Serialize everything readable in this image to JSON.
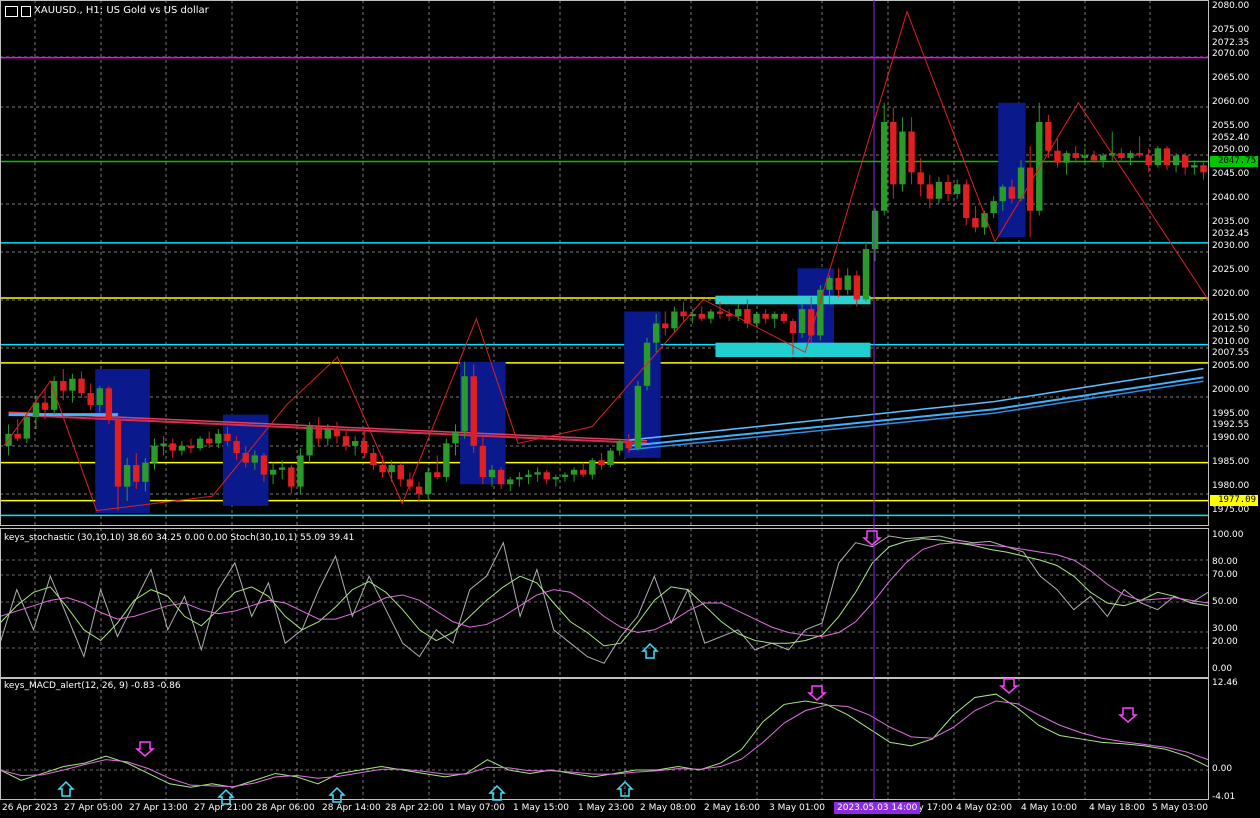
{
  "header": {
    "symbol_title": "XAUUSD., H1: US Gold vs US dollar"
  },
  "price_axis": {
    "labels": [
      "2080.00",
      "2075.00",
      "2072.35",
      "2070.00",
      "2065.00",
      "2060.00",
      "2055.00",
      "2052.40",
      "2050.00",
      "2047.75",
      "2045.00",
      "2040.00",
      "2035.00",
      "2032.45",
      "2030.00",
      "2025.00",
      "2020.00",
      "2015.00",
      "2012.50",
      "2010.00",
      "2007.55",
      "2005.00",
      "2000.00",
      "1995.00",
      "1992.55",
      "1990.00",
      "1985.00",
      "1980.00",
      "1977.09",
      "1975.00"
    ],
    "current_price": "2047.75",
    "highlight_price": "1977.09",
    "colors": {
      "magenta": "#ff00ff",
      "cyan": "#00e5ff",
      "yellow": "#ffff00",
      "green": "#00c800",
      "current_bg": "#00c800",
      "highlight_bg": "#ffff00"
    }
  },
  "stochastic": {
    "label": "keys_stochastic (30,10,10) 38.60 34.25 0.00 0.00 Stoch(30,10,1) 55.09 39.41",
    "axis": [
      "100.00",
      "80.00",
      "70.00",
      "50.00",
      "30.00",
      "20.00",
      "0.00"
    ]
  },
  "macd": {
    "label": "keys_MACD_alert(12, 26, 9) -0.83 -0.86",
    "axis": [
      "12.46",
      "0.00",
      "-4.01"
    ]
  },
  "time_axis": {
    "labels": [
      "26 Apr 2023",
      "27 Apr 05:00",
      "27 Apr 13:00",
      "27 Apr 21:00",
      "28 Apr 06:00",
      "28 Apr 14:00",
      "28 Apr 22:00",
      "1 May 07:00",
      "1 May 15:00",
      "1 May 23:00",
      "2 May 08:00",
      "2 May 16:00",
      "3 May 01:00",
      "ay 17:00",
      "4 May 02:00",
      "4 May 10:00",
      "4 May 18:00",
      "5 May 03:00"
    ],
    "crosshair": "2023.05.03 14:00"
  },
  "chart_data": {
    "type": "candlestick",
    "symbol": "XAUUSD.",
    "timeframe": "H1",
    "ylim": [
      1972,
      2081
    ],
    "horizontal_levels": [
      {
        "price": 2069.4,
        "color": "#ff00ff"
      },
      {
        "price": 2047.75,
        "color": "#00c800"
      },
      {
        "price": 2030.8,
        "color": "#00e5ff"
      },
      {
        "price": 2019.3,
        "color": "#ffff00"
      },
      {
        "price": 2009.6,
        "color": "#00e5ff"
      },
      {
        "price": 2005.8,
        "color": "#ffff00"
      },
      {
        "price": 1985.0,
        "color": "#ffff00"
      },
      {
        "price": 1977.09,
        "color": "#ffff00"
      },
      {
        "price": 1974.0,
        "color": "#00e5ff"
      }
    ],
    "candles": [
      [
        1988.5,
        1993.0,
        1986.5,
        1991.0
      ],
      [
        1991.0,
        1994.0,
        1989.5,
        1990.0
      ],
      [
        1990.0,
        1995.5,
        1989.0,
        1994.5
      ],
      [
        1994.5,
        1999.0,
        1992.0,
        1997.5
      ],
      [
        1997.5,
        2000.5,
        1994.0,
        1996.0
      ],
      [
        1996.0,
        2003.0,
        1995.0,
        2002.0
      ],
      [
        2002.0,
        2004.5,
        1998.0,
        2000.0
      ],
      [
        2000.0,
        2003.5,
        1997.5,
        2002.5
      ],
      [
        2002.5,
        2004.0,
        1998.5,
        1999.5
      ],
      [
        1999.5,
        2001.5,
        1996.0,
        1997.0
      ],
      [
        1997.0,
        2001.0,
        1995.5,
        2000.5
      ],
      [
        2000.5,
        2001.0,
        1993.0,
        1994.0
      ],
      [
        1994.0,
        1995.0,
        1975.0,
        1980.0
      ],
      [
        1980.0,
        1986.0,
        1977.0,
        1984.5
      ],
      [
        1984.5,
        1987.0,
        1979.5,
        1981.0
      ],
      [
        1981.0,
        1986.0,
        1979.0,
        1985.0
      ],
      [
        1985.0,
        1990.0,
        1983.5,
        1988.5
      ],
      [
        1988.5,
        1990.5,
        1986.5,
        1989.0
      ],
      [
        1989.0,
        1990.0,
        1986.0,
        1987.5
      ],
      [
        1987.5,
        1989.5,
        1986.5,
        1988.5
      ],
      [
        1988.5,
        1990.0,
        1987.0,
        1988.0
      ],
      [
        1988.0,
        1990.5,
        1987.5,
        1990.0
      ],
      [
        1990.0,
        1991.5,
        1988.0,
        1989.0
      ],
      [
        1989.0,
        1992.0,
        1988.0,
        1991.0
      ],
      [
        1991.0,
        1992.5,
        1988.5,
        1989.5
      ],
      [
        1989.5,
        1990.5,
        1985.5,
        1987.0
      ],
      [
        1987.0,
        1988.5,
        1984.0,
        1985.0
      ],
      [
        1985.0,
        1987.5,
        1983.5,
        1986.5
      ],
      [
        1986.5,
        1987.0,
        1981.0,
        1982.5
      ],
      [
        1982.5,
        1985.0,
        1980.5,
        1983.5
      ],
      [
        1983.5,
        1985.5,
        1981.5,
        1984.0
      ],
      [
        1984.0,
        1984.5,
        1978.5,
        1980.0
      ],
      [
        1980.0,
        1988.0,
        1978.5,
        1986.5
      ],
      [
        1986.5,
        1993.5,
        1985.0,
        1992.5
      ],
      [
        1992.5,
        1994.5,
        1988.5,
        1990.0
      ],
      [
        1990.0,
        1993.0,
        1988.5,
        1992.0
      ],
      [
        1992.0,
        1993.5,
        1989.0,
        1990.5
      ],
      [
        1990.5,
        1992.0,
        1987.5,
        1988.5
      ],
      [
        1988.5,
        1990.5,
        1986.5,
        1989.5
      ],
      [
        1989.5,
        1991.5,
        1986.0,
        1987.0
      ],
      [
        1987.0,
        1988.0,
        1983.5,
        1984.5
      ],
      [
        1984.5,
        1986.5,
        1982.0,
        1983.0
      ],
      [
        1983.0,
        1985.5,
        1981.0,
        1984.5
      ],
      [
        1984.5,
        1985.0,
        1980.0,
        1981.5
      ],
      [
        1981.5,
        1983.0,
        1979.0,
        1980.0
      ],
      [
        1980.0,
        1981.0,
        1977.0,
        1978.5
      ],
      [
        1978.5,
        1984.0,
        1977.5,
        1983.0
      ],
      [
        1983.0,
        1986.5,
        1981.5,
        1982.0
      ],
      [
        1982.0,
        1990.0,
        1981.0,
        1989.0
      ],
      [
        1989.0,
        1993.0,
        1986.5,
        1991.5
      ],
      [
        1991.5,
        2006.0,
        1990.0,
        2003.0
      ],
      [
        2003.0,
        2005.5,
        1987.0,
        1988.5
      ],
      [
        1988.5,
        1990.5,
        1980.5,
        1982.0
      ],
      [
        1982.0,
        1984.5,
        1980.0,
        1983.5
      ],
      [
        1983.5,
        1984.0,
        1979.5,
        1980.5
      ],
      [
        1980.5,
        1982.0,
        1979.0,
        1981.5
      ],
      [
        1981.5,
        1983.0,
        1980.0,
        1982.0
      ],
      [
        1982.0,
        1983.5,
        1980.5,
        1982.5
      ],
      [
        1982.5,
        1984.0,
        1981.0,
        1983.0
      ],
      [
        1983.0,
        1983.5,
        1980.5,
        1981.5
      ],
      [
        1981.5,
        1982.5,
        1980.0,
        1982.0
      ],
      [
        1982.0,
        1983.0,
        1981.0,
        1982.5
      ],
      [
        1982.5,
        1984.0,
        1981.0,
        1983.5
      ],
      [
        1983.5,
        1985.0,
        1982.0,
        1982.5
      ],
      [
        1982.5,
        1986.0,
        1981.5,
        1985.5
      ],
      [
        1985.5,
        1987.0,
        1983.5,
        1984.5
      ],
      [
        1984.5,
        1988.0,
        1984.0,
        1987.5
      ],
      [
        1987.5,
        1990.0,
        1986.5,
        1989.5
      ],
      [
        1989.5,
        1991.0,
        1987.0,
        1988.0
      ],
      [
        1988.0,
        2002.0,
        1987.5,
        2001.0
      ],
      [
        2001.0,
        2011.0,
        2000.0,
        2010.0
      ],
      [
        2010.0,
        2016.0,
        2008.0,
        2014.0
      ],
      [
        2014.0,
        2016.5,
        2011.5,
        2013.0
      ],
      [
        2013.0,
        2017.5,
        2012.0,
        2016.5
      ],
      [
        2016.5,
        2018.5,
        2014.5,
        2015.5
      ],
      [
        2015.5,
        2017.0,
        2014.0,
        2016.0
      ],
      [
        2016.0,
        2017.5,
        2014.5,
        2015.0
      ],
      [
        2015.0,
        2017.0,
        2014.0,
        2016.5
      ],
      [
        2016.5,
        2018.5,
        2015.0,
        2016.0
      ],
      [
        2016.0,
        2017.0,
        2014.5,
        2015.5
      ],
      [
        2015.5,
        2018.0,
        2014.5,
        2017.0
      ],
      [
        2017.0,
        2019.0,
        2013.0,
        2014.0
      ],
      [
        2014.0,
        2016.5,
        2013.5,
        2016.0
      ],
      [
        2016.0,
        2017.0,
        2014.0,
        2015.0
      ],
      [
        2015.0,
        2016.5,
        2013.0,
        2016.0
      ],
      [
        2016.0,
        2016.5,
        2014.0,
        2014.5
      ],
      [
        2014.5,
        2015.0,
        2007.5,
        2012.0
      ],
      [
        2012.0,
        2018.0,
        2011.0,
        2017.0
      ],
      [
        2017.0,
        2019.5,
        2010.0,
        2011.5
      ],
      [
        2011.5,
        2022.0,
        2010.5,
        2021.0
      ],
      [
        2021.0,
        2024.0,
        2018.0,
        2023.5
      ],
      [
        2023.5,
        2025.5,
        2019.5,
        2021.0
      ],
      [
        2021.0,
        2025.5,
        2020.0,
        2024.0
      ],
      [
        2024.0,
        2025.0,
        2017.5,
        2019.0
      ],
      [
        2019.0,
        2031.0,
        2018.5,
        2029.5
      ],
      [
        2029.5,
        2038.0,
        2027.0,
        2037.5
      ],
      [
        2037.5,
        2060.0,
        2036.5,
        2056.0
      ],
      [
        2056.0,
        2059.0,
        2040.0,
        2043.0
      ],
      [
        2043.0,
        2057.0,
        2041.5,
        2054.0
      ],
      [
        2054.0,
        2057.0,
        2043.0,
        2045.5
      ],
      [
        2045.5,
        2048.5,
        2040.5,
        2043.0
      ],
      [
        2043.0,
        2045.0,
        2038.0,
        2040.0
      ],
      [
        2040.0,
        2044.5,
        2039.0,
        2043.5
      ],
      [
        2043.5,
        2045.0,
        2039.5,
        2041.0
      ],
      [
        2041.0,
        2044.0,
        2040.0,
        2043.0
      ],
      [
        2043.0,
        2044.0,
        2034.5,
        2036.0
      ],
      [
        2036.0,
        2038.5,
        2033.0,
        2034.0
      ],
      [
        2034.0,
        2037.5,
        2032.5,
        2037.0
      ],
      [
        2037.0,
        2040.5,
        2036.0,
        2039.5
      ],
      [
        2039.5,
        2043.0,
        2037.5,
        2042.5
      ],
      [
        2042.5,
        2044.0,
        2039.0,
        2040.0
      ],
      [
        2040.0,
        2048.0,
        2039.5,
        2046.5
      ],
      [
        2046.5,
        2051.0,
        2032.0,
        2037.5
      ],
      [
        2037.5,
        2060.0,
        2036.5,
        2056.0
      ],
      [
        2056.0,
        2057.5,
        2048.5,
        2050.0
      ],
      [
        2050.0,
        2052.5,
        2046.5,
        2047.5
      ],
      [
        2047.5,
        2050.0,
        2045.0,
        2049.5
      ],
      [
        2049.5,
        2051.0,
        2047.5,
        2048.5
      ],
      [
        2048.5,
        2050.5,
        2047.0,
        2049.0
      ],
      [
        2049.0,
        2050.0,
        2047.5,
        2048.0
      ],
      [
        2048.0,
        2049.5,
        2046.5,
        2049.0
      ],
      [
        2049.0,
        2054.0,
        2048.0,
        2049.5
      ],
      [
        2049.5,
        2050.5,
        2048.0,
        2048.5
      ],
      [
        2048.5,
        2050.0,
        2047.0,
        2049.5
      ],
      [
        2049.5,
        2053.0,
        2048.5,
        2049.0
      ],
      [
        2049.0,
        2050.5,
        2045.5,
        2047.0
      ],
      [
        2047.0,
        2051.0,
        2046.5,
        2050.5
      ],
      [
        2050.5,
        2051.0,
        2046.0,
        2047.0
      ],
      [
        2047.0,
        2049.5,
        2045.5,
        2049.0
      ],
      [
        2049.0,
        2049.5,
        2045.0,
        2046.5
      ],
      [
        2046.5,
        2048.0,
        2045.0,
        2047.0
      ],
      [
        2047.0,
        2047.5,
        2044.0,
        2045.5
      ]
    ],
    "zigzag": [
      [
        0,
        1988.5
      ],
      [
        10,
        2002.0
      ],
      [
        20,
        1975.0
      ],
      [
        45,
        1978.0
      ],
      [
        61,
        1997.0
      ],
      [
        72,
        2007.0
      ],
      [
        86,
        1976.5
      ],
      [
        102,
        2015.0
      ],
      [
        111,
        1989.0
      ],
      [
        127,
        1992.5
      ],
      [
        151,
        2019.0
      ],
      [
        173,
        2008.0
      ],
      [
        195,
        2079.0
      ],
      [
        214,
        2031.0
      ],
      [
        232,
        2060.0
      ],
      [
        260,
        2019.0
      ]
    ],
    "stochastic": {
      "main": [
        35,
        48,
        58,
        62,
        47,
        30,
        22,
        35,
        52,
        60,
        55,
        40,
        33,
        45,
        58,
        62,
        55,
        40,
        30,
        36,
        47,
        60,
        66,
        58,
        45,
        30,
        22,
        28,
        40,
        52,
        62,
        70,
        65,
        50,
        36,
        28,
        18,
        20,
        35,
        52,
        62,
        60,
        48,
        36,
        27,
        22,
        20,
        20,
        22,
        26,
        40,
        58,
        80,
        92,
        96,
        98,
        97,
        95,
        93,
        90,
        88,
        85,
        82,
        78,
        70,
        58,
        50,
        48,
        52,
        58,
        55,
        50,
        48
      ],
      "signal": [
        40,
        44,
        48,
        52,
        54,
        50,
        43,
        38,
        40,
        44,
        48,
        50,
        45,
        42,
        44,
        48,
        52,
        50,
        44,
        38,
        38,
        42,
        48,
        54,
        56,
        52,
        44,
        36,
        32,
        34,
        40,
        48,
        56,
        60,
        58,
        50,
        40,
        32,
        28,
        30,
        36,
        44,
        50,
        50,
        44,
        38,
        32,
        28,
        26,
        25,
        28,
        36,
        50,
        66,
        80,
        90,
        94,
        95,
        94,
        93,
        92,
        90,
        88,
        86,
        82,
        74,
        64,
        56,
        52,
        53,
        54,
        52,
        50
      ],
      "fast": [
        20,
        60,
        30,
        70,
        40,
        10,
        60,
        25,
        50,
        75,
        30,
        55,
        15,
        60,
        80,
        40,
        65,
        20,
        30,
        60,
        85,
        40,
        70,
        45,
        20,
        10,
        30,
        20,
        60,
        70,
        95,
        40,
        75,
        30,
        20,
        10,
        5,
        25,
        40,
        70,
        35,
        60,
        20,
        25,
        30,
        15,
        20,
        15,
        30,
        35,
        80,
        95,
        92,
        100,
        98,
        99,
        100,
        97,
        95,
        96,
        92,
        88,
        70,
        60,
        45,
        55,
        40,
        60,
        50,
        45,
        55,
        50,
        58
      ]
    },
    "macd": {
      "main": [
        0,
        -1.5,
        -0.5,
        0.5,
        1.0,
        2.0,
        1.0,
        -0.5,
        -2.0,
        -2.5,
        -2.0,
        -2.5,
        -1.5,
        -0.5,
        -1.0,
        -2.0,
        -0.5,
        0.0,
        0.5,
        0.0,
        -0.5,
        -1.0,
        -0.5,
        1.5,
        0.0,
        -0.5,
        0.0,
        -0.5,
        -1.0,
        -0.5,
        0.0,
        0.0,
        0.5,
        0.0,
        1.0,
        3.0,
        7.0,
        9.5,
        10.0,
        9.5,
        8.0,
        6.0,
        4.0,
        3.5,
        4.5,
        8.0,
        10.5,
        11.0,
        9.0,
        6.5,
        5.0,
        4.5,
        4.0,
        3.8,
        3.5,
        3.0,
        2.0,
        0.5
      ],
      "signal": [
        0,
        -0.8,
        -0.7,
        0.0,
        0.8,
        1.5,
        1.2,
        0.2,
        -1.2,
        -2.2,
        -2.3,
        -2.4,
        -1.9,
        -1.0,
        -0.8,
        -1.2,
        -0.9,
        -0.4,
        0.1,
        0.1,
        -0.2,
        -0.6,
        -0.6,
        0.4,
        0.3,
        -0.1,
        -0.1,
        -0.3,
        -0.6,
        -0.6,
        -0.3,
        -0.1,
        0.2,
        0.1,
        0.5,
        1.6,
        4.0,
        6.8,
        8.6,
        9.4,
        9.2,
        8.0,
        6.2,
        4.8,
        4.6,
        6.2,
        8.6,
        10.0,
        9.6,
        8.0,
        6.5,
        5.4,
        4.6,
        4.1,
        3.7,
        3.3,
        2.6,
        1.5
      ]
    }
  }
}
